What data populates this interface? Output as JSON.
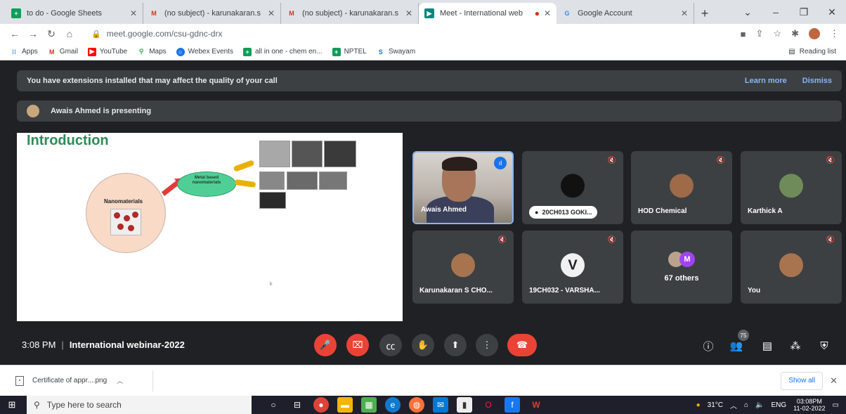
{
  "browser": {
    "tabs": [
      {
        "label": "to do - Google Sheets",
        "icon": "sheets-icon",
        "color": "#0f9d58"
      },
      {
        "label": "(no subject) - karunakaran.s",
        "icon": "gmail-icon",
        "color": "#d93025"
      },
      {
        "label": "(no subject) - karunakaran.s",
        "icon": "gmail-icon",
        "color": "#d93025"
      },
      {
        "label": "Meet - International web",
        "icon": "meet-icon",
        "color": "#00897b",
        "active": true
      },
      {
        "label": "Google Account",
        "icon": "google-icon",
        "color": "#4285f4"
      }
    ],
    "url": "meet.google.com/csu-gdnc-drx",
    "bookmarks": [
      {
        "label": "Apps",
        "icon": "apps-grid-icon",
        "color": "#4285f4"
      },
      {
        "label": "Gmail",
        "icon": "gmail-icon",
        "color": "#d93025"
      },
      {
        "label": "YouTube",
        "icon": "youtube-icon",
        "color": "#ff0000"
      },
      {
        "label": "Maps",
        "icon": "maps-icon",
        "color": "#34a853"
      },
      {
        "label": "Webex Events",
        "icon": "webex-icon",
        "color": "#1a73e8"
      },
      {
        "label": "all in one - chem en...",
        "icon": "sheets-icon",
        "color": "#0f9d58"
      },
      {
        "label": "NPTEL",
        "icon": "sheets-icon",
        "color": "#0f9d58"
      },
      {
        "label": "Swayam",
        "icon": "swayam-icon",
        "color": "#1a73e8"
      }
    ],
    "reading_list": "Reading list"
  },
  "meet": {
    "banner_text": "You have extensions installed that may affect the quality of your call",
    "learn_more": "Learn more",
    "dismiss": "Dismiss",
    "presenting_text": "Awais Ahmed is presenting",
    "slide": {
      "title": "Introduction",
      "nano_label": "Nanomaterials",
      "metal_label": "Metal based nanomaterials",
      "mark": "k"
    },
    "tiles": [
      {
        "name": "Awais Ahmed",
        "type": "video"
      },
      {
        "name": "20CH013 GOKI...",
        "type": "pill"
      },
      {
        "name": "HOD Chemical",
        "type": "avatar"
      },
      {
        "name": "Karthick A",
        "type": "avatar"
      },
      {
        "name": "Karunakaran S CHO...",
        "type": "avatar"
      },
      {
        "name": "19CH032 - VARSHA...",
        "type": "letter",
        "letter": "V"
      },
      {
        "name": "67 others",
        "type": "others",
        "letter": "M"
      },
      {
        "name": "You",
        "type": "avatar"
      }
    ],
    "time": "3:08 PM",
    "meeting_name": "International webinar-2022",
    "participant_count": "75"
  },
  "download": {
    "file": "Certificate of appr....png",
    "show_all": "Show all"
  },
  "taskbar": {
    "search_placeholder": "Type here to search",
    "weather": "31°C",
    "lang": "ENG",
    "clock_time": "03:08PM",
    "clock_date": "11-02-2022"
  },
  "colors": {
    "meet_bg": "#202124",
    "tile_bg": "#3c4043",
    "accent_blue": "#8ab4f8",
    "red": "#ea4335"
  }
}
